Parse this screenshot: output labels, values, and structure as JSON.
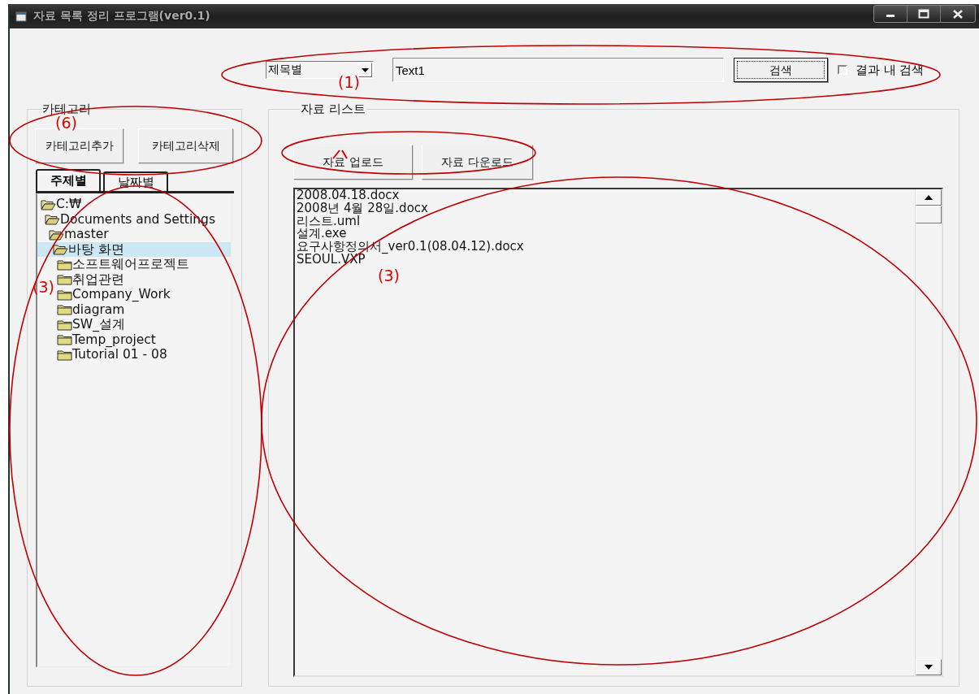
{
  "window": {
    "title": "자료 목록 정리 프로그램(ver0.1)"
  },
  "search": {
    "type_combo": "제목별",
    "query": "Text1",
    "button": "검색",
    "within_results": {
      "label": "결과 내 검색",
      "checked": false
    }
  },
  "category": {
    "title": "카테고리",
    "buttons": [
      "카테고리추가",
      "카테고리삭제"
    ],
    "tabs": [
      {
        "label": "주제별",
        "selected": true
      },
      {
        "label": "날짜별",
        "selected": false
      }
    ],
    "tree": [
      {
        "label": "C:₩",
        "expanded": true,
        "selected": false,
        "children": [
          {
            "label": "Documents and Settings",
            "expanded": true,
            "selected": false,
            "children": [
              {
                "label": "master",
                "expanded": true,
                "selected": false,
                "children": [
                  {
                    "label": "바탕 화면",
                    "expanded": true,
                    "selected": true,
                    "children": [
                      {
                        "label": "소프트웨어프로젝트",
                        "expanded": false,
                        "selected": false
                      },
                      {
                        "label": "취업관련",
                        "expanded": false,
                        "selected": false
                      },
                      {
                        "label": "Company_Work",
                        "expanded": false,
                        "selected": false
                      },
                      {
                        "label": "diagram",
                        "expanded": false,
                        "selected": false
                      },
                      {
                        "label": "SW_설계",
                        "expanded": false,
                        "selected": false
                      },
                      {
                        "label": "Temp_project",
                        "expanded": false,
                        "selected": false
                      },
                      {
                        "label": "Tutorial 01 - 08",
                        "expanded": false,
                        "selected": false
                      }
                    ]
                  }
                ]
              }
            ]
          }
        ]
      }
    ]
  },
  "data_list": {
    "title": "자료 리스트",
    "buttons": [
      "자료 업로드",
      "자료 다운로드"
    ],
    "files": [
      "2008.04.18.docx",
      "2008년 4월 28일.docx",
      "리스트.uml",
      "설계.exe",
      "요구사항정의서_ver0.1(08.04.12).docx",
      "SEOUL.VXP"
    ]
  },
  "annotations": [
    {
      "kind": "labeled",
      "label": "(1)"
    },
    {
      "kind": "labeled",
      "label": "(6)"
    },
    {
      "kind": "labeled",
      "label": "(3)"
    },
    {
      "kind": "mark"
    },
    {
      "kind": "labeled",
      "label": "(3)"
    }
  ]
}
